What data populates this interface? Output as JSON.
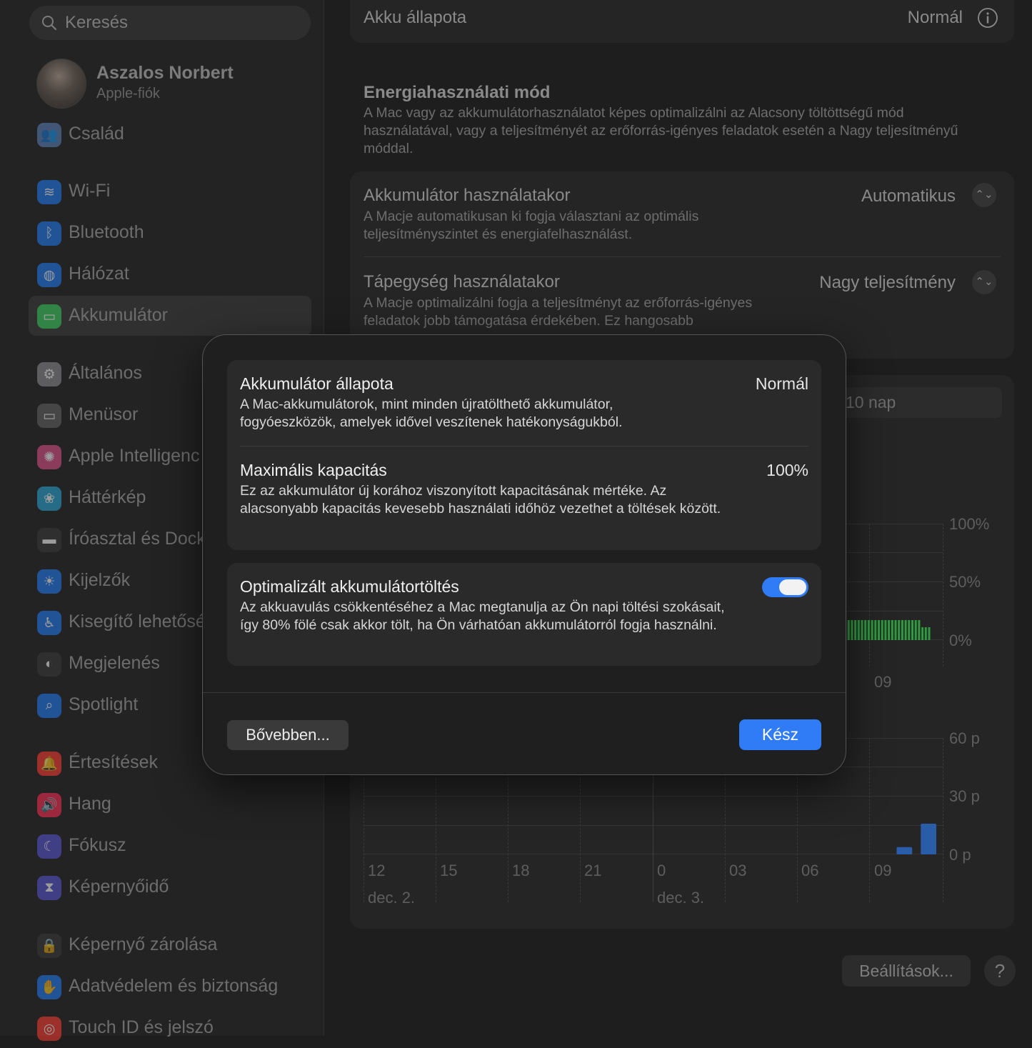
{
  "search": {
    "placeholder": "Keresés"
  },
  "account": {
    "name": "Aszalos Norbert",
    "subtitle": "Apple-fiók"
  },
  "family": {
    "label": "Család"
  },
  "sidebar": {
    "items": [
      {
        "label": "Wi-Fi",
        "icon": "wifi-icon",
        "color": "#1f7cf6"
      },
      {
        "label": "Bluetooth",
        "icon": "bluetooth-icon",
        "color": "#1f7cf6"
      },
      {
        "label": "Hálózat",
        "icon": "globe-icon",
        "color": "#1f7cf6"
      },
      {
        "label": "Akkumulátor",
        "icon": "battery-icon",
        "color": "#34c759"
      },
      {
        "label": "Általános",
        "icon": "gear-icon",
        "color": "#8e8e93"
      },
      {
        "label": "Menüsor",
        "icon": "menubar-icon",
        "color": "#636366"
      },
      {
        "label": "Apple Intelligenc",
        "icon": "apple-intelligence-icon",
        "color": "#e0528a"
      },
      {
        "label": "Háttérkép",
        "icon": "wallpaper-icon",
        "color": "#29a8d8"
      },
      {
        "label": "Íróasztal és Dock",
        "icon": "dock-icon",
        "color": "#3a3a3c"
      },
      {
        "label": "Kijelzők",
        "icon": "sun-icon",
        "color": "#1f7cf6"
      },
      {
        "label": "Kisegítő lehetősé",
        "icon": "accessibility-icon",
        "color": "#1f7cf6"
      },
      {
        "label": "Megjelenés",
        "icon": "appearance-icon",
        "color": "#3a3a3c"
      },
      {
        "label": "Spotlight",
        "icon": "search-icon",
        "color": "#1f7cf6"
      },
      {
        "label": "Értesítések",
        "icon": "bell-icon",
        "color": "#ff3b30"
      },
      {
        "label": "Hang",
        "icon": "speaker-icon",
        "color": "#ff2d55"
      },
      {
        "label": "Fókusz",
        "icon": "moon-icon",
        "color": "#5856d6"
      },
      {
        "label": "Képernyőidő",
        "icon": "hourglass-icon",
        "color": "#5856d6"
      },
      {
        "label": "Képernyő zárolása",
        "icon": "lock-icon",
        "color": "#3a3a3c"
      },
      {
        "label": "Adatvédelem és biztonság",
        "icon": "hand-icon",
        "color": "#1f7cf6"
      },
      {
        "label": "Touch ID és jelszó",
        "icon": "fingerprint-icon",
        "color": "#ff3b30"
      }
    ]
  },
  "main": {
    "battery_health": {
      "label": "Akku állapota",
      "value": "Normál"
    },
    "energy_mode": {
      "title": "Energiahasználati mód",
      "desc": "A Mac vagy az akkumulátorhasználatot képes optimalizálni az Alacsony töltöttségű mód használatával, vagy a teljesítményét az erőforrás-igényes feladatok esetén a Nagy teljesítményű móddal."
    },
    "on_battery": {
      "title": "Akkumulátor használatakor",
      "desc": "A Macje automatikusan ki fogja választani az optimális teljesítményszintet és energiafelhasználást.",
      "value": "Automatikus"
    },
    "on_power": {
      "title": "Tápegység használatakor",
      "desc": "A Macje optimalizálni fogja a teljesítményt az erőforrás-igényes feladatok jobb támogatása érdekében. Ez hangosabb",
      "value": "Nagy teljesítmény"
    },
    "range_partial": "10 nap",
    "settings_btn": "Beállítások...",
    "help_btn": "?"
  },
  "chart_data": [
    {
      "type": "bar",
      "y_ticks": [
        "100%",
        "50%",
        "0%"
      ],
      "x_ticks": [
        "09"
      ]
    },
    {
      "type": "bar",
      "y_ticks": [
        "60 p",
        "30 p",
        "0 p"
      ],
      "x_ticks": [
        "12",
        "15",
        "18",
        "21",
        "0",
        "03",
        "06",
        "09"
      ],
      "date_labels": [
        "dec. 2.",
        "dec. 3."
      ],
      "bars": [
        {
          "x": "10",
          "value": 5
        },
        {
          "x": "11",
          "value": 21
        }
      ]
    }
  ],
  "modal": {
    "health": {
      "title": "Akkumulátor állapota",
      "value": "Normál",
      "desc": "A Mac-akkumulátorok, mint minden újratölthető akkumulátor, fogyóeszközök, amelyek idővel veszítenek hatékonyságukból."
    },
    "capacity": {
      "title": "Maximális kapacitás",
      "value": "100%",
      "desc": "Ez az akkumulátor új korához viszonyított kapacitásának mértéke. Az alacsonyabb kapacitás kevesebb használati időhöz vezethet a töltések között."
    },
    "optimized": {
      "title": "Optimalizált akkumulátortöltés",
      "desc": "Az akkuavulás csökkentéséhez a Mac megtanulja az Ön napi töltési szokásait, így 80% fölé csak akkor tölt, ha Ön várhatóan akkumulátorról fogja használni.",
      "enabled": true
    },
    "more_btn": "Bővebben...",
    "done_btn": "Kész"
  }
}
